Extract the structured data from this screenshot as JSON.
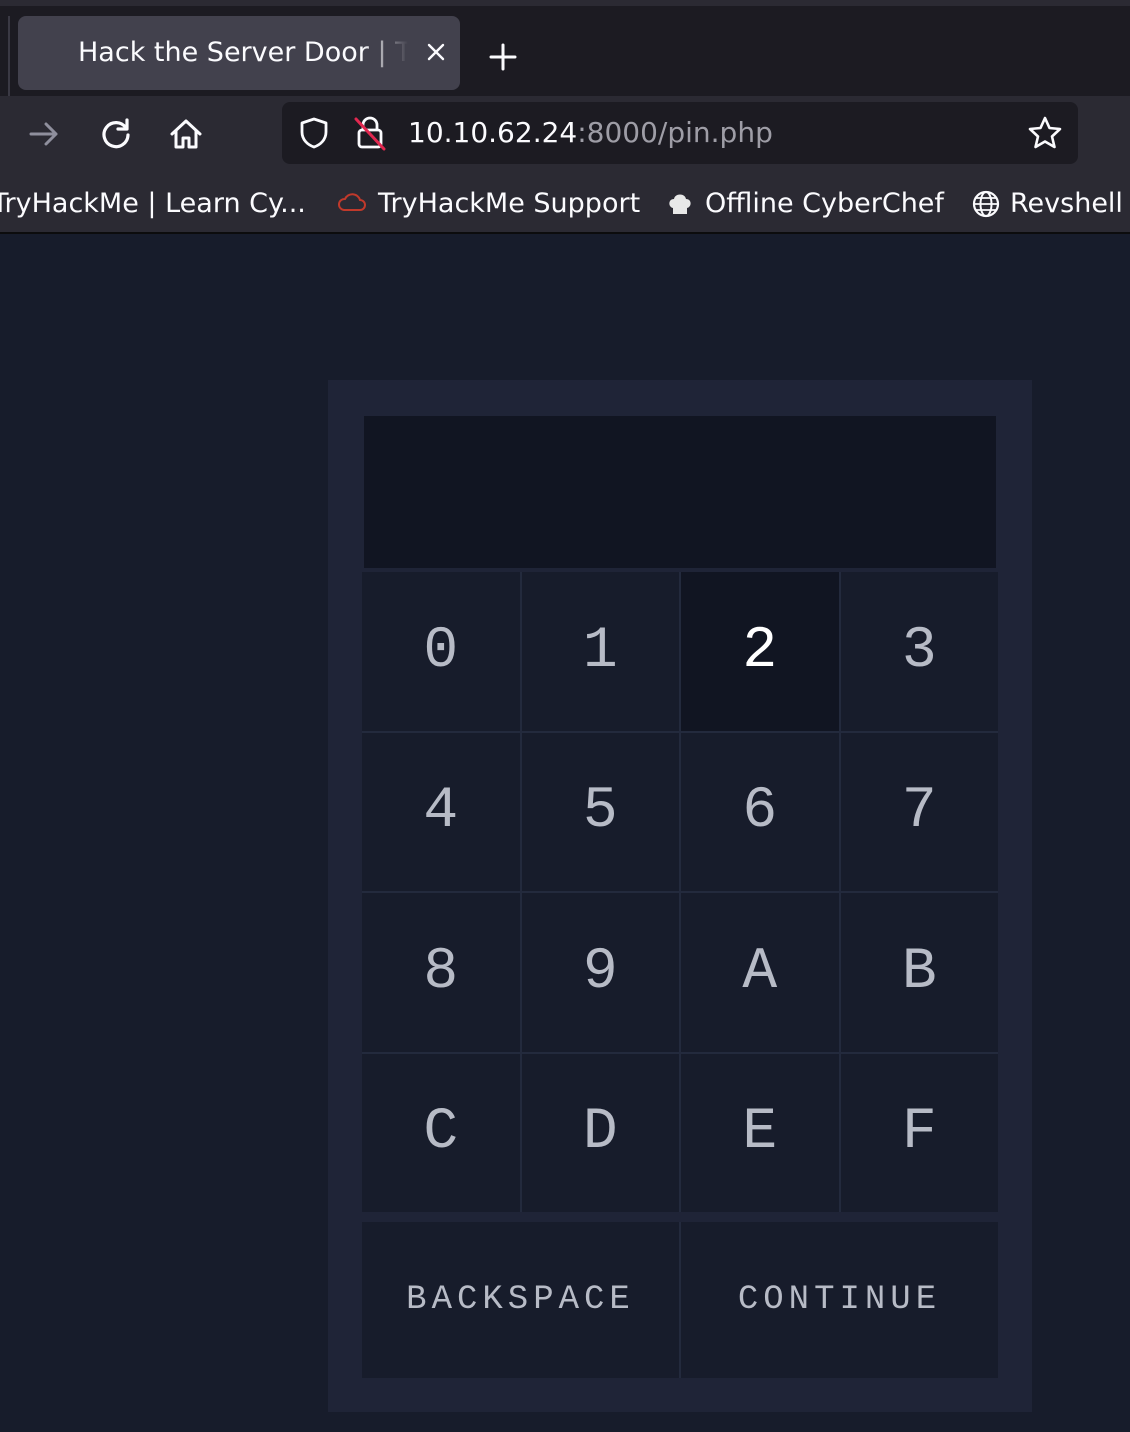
{
  "browser": {
    "tab": {
      "title": "Hack the Server Door | TryHackMe"
    },
    "url": {
      "host": "10.10.62.24",
      "rest": ":8000/pin.php"
    },
    "bookmarks": [
      {
        "label": "TryHackMe | Learn Cy...",
        "icon": "none"
      },
      {
        "label": "TryHackMe Support",
        "icon": "cloud-icon"
      },
      {
        "label": "Offline CyberChef",
        "icon": "chef-hat-icon"
      },
      {
        "label": "Revshell",
        "icon": "globe-icon"
      }
    ]
  },
  "keypad": {
    "display_value": "",
    "active_key": "2",
    "keys": [
      "0",
      "1",
      "2",
      "3",
      "4",
      "5",
      "6",
      "7",
      "8",
      "9",
      "A",
      "B",
      "C",
      "D",
      "E",
      "F"
    ],
    "backspace_label": "BACKSPACE",
    "continue_label": "CONTINUE"
  },
  "colors": {
    "page_bg": "#171c2b",
    "panel_bg": "#1f2437",
    "display_bg": "#111522",
    "key_text": "#b7bbc6"
  }
}
